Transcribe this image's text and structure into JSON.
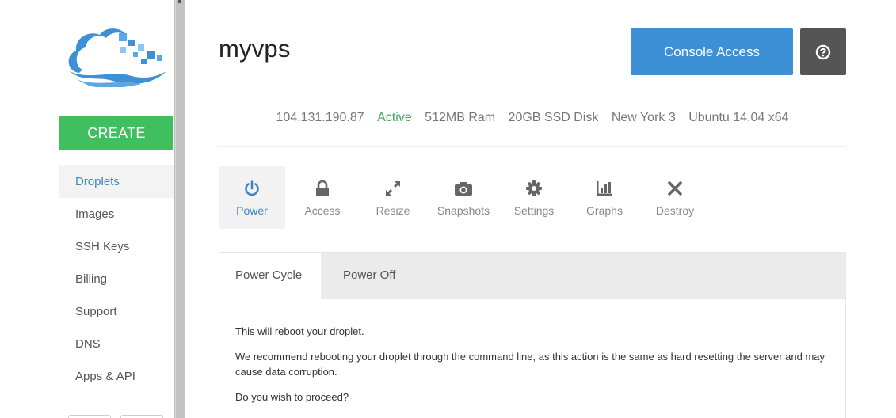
{
  "app": {
    "create_label": "CREATE",
    "brand_color": "#3d8fd6",
    "create_color": "#3fbf5f"
  },
  "sidebar": {
    "items": [
      {
        "label": "Droplets",
        "active": true
      },
      {
        "label": "Images"
      },
      {
        "label": "SSH Keys"
      },
      {
        "label": "Billing"
      },
      {
        "label": "Support"
      },
      {
        "label": "DNS"
      },
      {
        "label": "Apps & API"
      }
    ]
  },
  "droplet": {
    "name": "myvps",
    "ip": "104.131.190.87",
    "status": "Active",
    "ram": "512MB Ram",
    "disk": "20GB SSD Disk",
    "region": "New York 3",
    "os": "Ubuntu 14.04 x64"
  },
  "header": {
    "console_label": "Console Access",
    "help_icon": "help-circle-icon"
  },
  "tabs": [
    {
      "label": "Power",
      "icon": "power-icon",
      "active": true
    },
    {
      "label": "Access",
      "icon": "lock-icon"
    },
    {
      "label": "Resize",
      "icon": "resize-icon"
    },
    {
      "label": "Snapshots",
      "icon": "camera-icon"
    },
    {
      "label": "Settings",
      "icon": "gear-icon"
    },
    {
      "label": "Graphs",
      "icon": "bar-chart-icon"
    },
    {
      "label": "Destroy",
      "icon": "close-icon"
    }
  ],
  "power": {
    "subtabs": [
      {
        "label": "Power Cycle",
        "active": true
      },
      {
        "label": "Power Off"
      }
    ],
    "body": {
      "line1": "This will reboot your droplet.",
      "line2": "We recommend rebooting your droplet through the command line, as this action is the same as hard resetting the server and may cause data corruption.",
      "line3": "Do you wish to proceed?"
    }
  }
}
